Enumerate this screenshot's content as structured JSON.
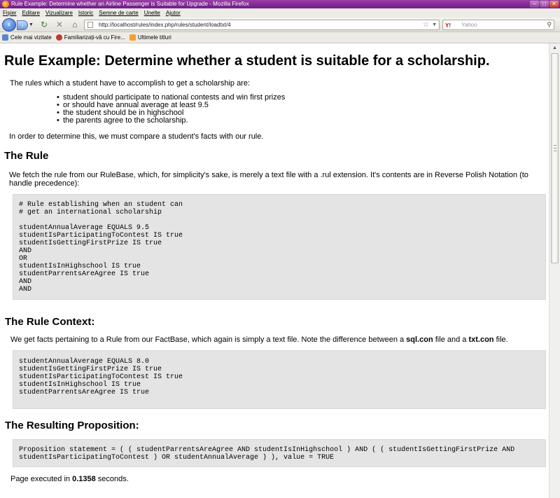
{
  "browser": {
    "window_title": "Rule Example: Determine whether an Airline Passenger is Suitable for Upgrade - Mozilla Firefox",
    "menu": [
      "Fișier",
      "Editare",
      "Vizualizare",
      "Istoric",
      "Semne de carte",
      "Unelte",
      "Ajutor"
    ],
    "url": "http://localhost/rules/index.php/rules/student/loadtxt/4",
    "search_placeholder": "Yahoo",
    "search_engine_icon": "Y!",
    "bookmarks": [
      "Cele mai vizitate",
      "Familiarizați-vă cu Fire...",
      "Ultimele titluri"
    ]
  },
  "page": {
    "title": "Rule Example: Determine whether a student is suitable for a scholarship.",
    "intro": "The rules which a student have to accomplish to get a scholarship are:",
    "rules": [
      "student should participate to national contests and win first prizes",
      "or should have annual average at least 9.5",
      "the student should be in highschool",
      "the parents agree to the scholarship."
    ],
    "compare_text": "In order to determine this, we must compare a student's facts with our rule.",
    "rule_heading": "The Rule",
    "rule_description": "We fetch the rule from our RuleBase, which, for simplicity's sake, is merely a text file with a .rul extension. It's contents are in Reverse Polish Notation (to handle precedence):",
    "rule_code": "# Rule establishing when an student can\n# get an international scholarship\n\nstudentAnnualAverage EQUALS 9.5\nstudentIsParticipatingToContest IS true\nstudentIsGettingFirstPrize IS true\nAND\nOR\nstudentIsInHighschool IS true\nstudentParrentsAreAgree IS true\nAND\nAND",
    "context_heading": "The Rule Context:",
    "context_text_1": "We get facts pertaining to a Rule from our FactBase, which again is simply a text file. Note the difference between a ",
    "context_bold_1": "sql.con",
    "context_text_2": " file and a ",
    "context_bold_2": "txt.con",
    "context_text_3": " file.",
    "context_code": "studentAnnualAverage EQUALS 8.0\nstudentIsGettingFirstPrize IS true\nstudentIsParticipatingToContest IS true\nstudentIsInHighschool IS true\nstudentParrentsAreAgree IS true",
    "proposition_heading": "The Resulting Proposition:",
    "proposition_code": "Proposition statement = ( ( studentParrentsAreAgree AND studentIsInHighschool ) AND ( ( studentIsGettingFirstPrize AND\nstudentIsParticipatingToContest ) OR studentAnnualAverage ) ), value = TRUE",
    "executed_prefix": "Page executed in ",
    "executed_time": "0.1358",
    "executed_suffix": " seconds."
  }
}
